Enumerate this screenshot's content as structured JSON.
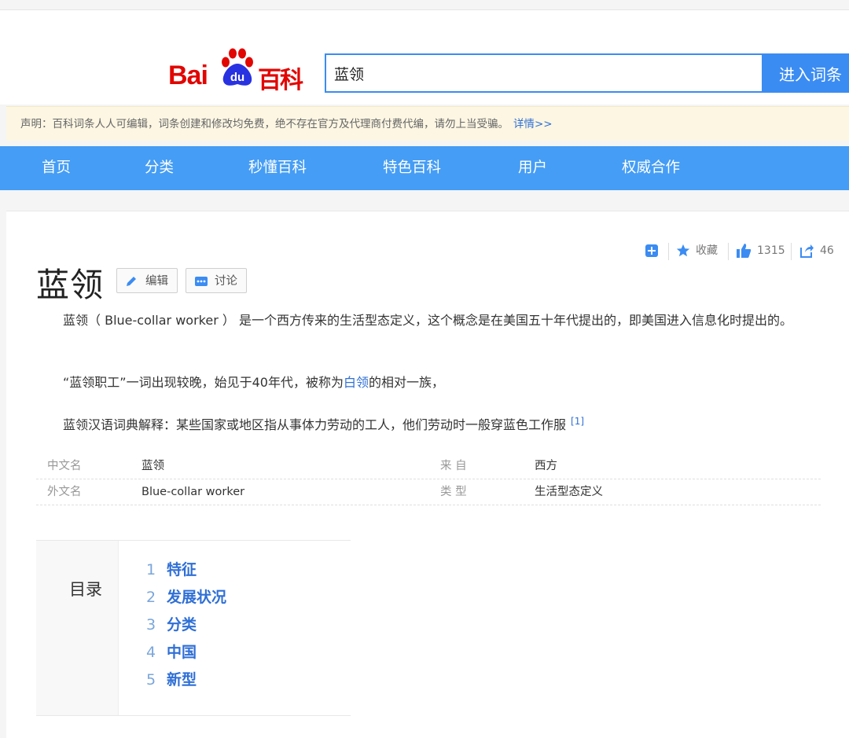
{
  "header": {
    "logo_text_left": "Bai",
    "logo_text_du": "du",
    "logo_text_right": "百科",
    "search_value": "蓝领",
    "search_button": "进入词条"
  },
  "notice": {
    "text": "声明：百科词条人人可编辑，词条创建和修改均免费，绝不存在官方及代理商付费代编，请勿上当受骗。",
    "link": "详情>>"
  },
  "nav": {
    "items": [
      "首页",
      "分类",
      "秒懂百科",
      "特色百科",
      "用户",
      "权威合作"
    ]
  },
  "tools": {
    "collect": "收藏",
    "likes": "1315",
    "shares": "46"
  },
  "article": {
    "title": "蓝领",
    "edit": "编辑",
    "discuss": "讨论",
    "para1": "蓝领（ Blue-collar worker ） 是一个西方传来的生活型态定义，这个概念是在美国五十年代提出的，即美国进入信息化时提出的。",
    "para2_before": "“蓝领职工”一词出现较晚，始见于40年代，被称为",
    "para2_link": "白领",
    "para2_after": "的相对一族，",
    "para3": "蓝领汉语词典解释：某些国家或地区指从事体力劳动的工人，他们劳动时一般穿蓝色工作服",
    "para3_ref": "[1]"
  },
  "info": {
    "rows": [
      {
        "k1": "中文名",
        "v1": "蓝领",
        "k2": "来 自",
        "v2": "西方"
      },
      {
        "k1": "外文名",
        "v1": "Blue-collar worker",
        "k2": "类 型",
        "v2": "生活型态定义"
      }
    ]
  },
  "toc": {
    "title": "目录",
    "entries": [
      {
        "n": "1",
        "label": "特征"
      },
      {
        "n": "2",
        "label": "发展状况"
      },
      {
        "n": "3",
        "label": "分类"
      },
      {
        "n": "4",
        "label": "中国"
      },
      {
        "n": "5",
        "label": "新型"
      }
    ]
  },
  "colors": {
    "brand_red": "#e10602",
    "accent_blue": "#3b8cf2",
    "nav_blue": "#459df5",
    "link_blue": "#2f6fd6"
  }
}
